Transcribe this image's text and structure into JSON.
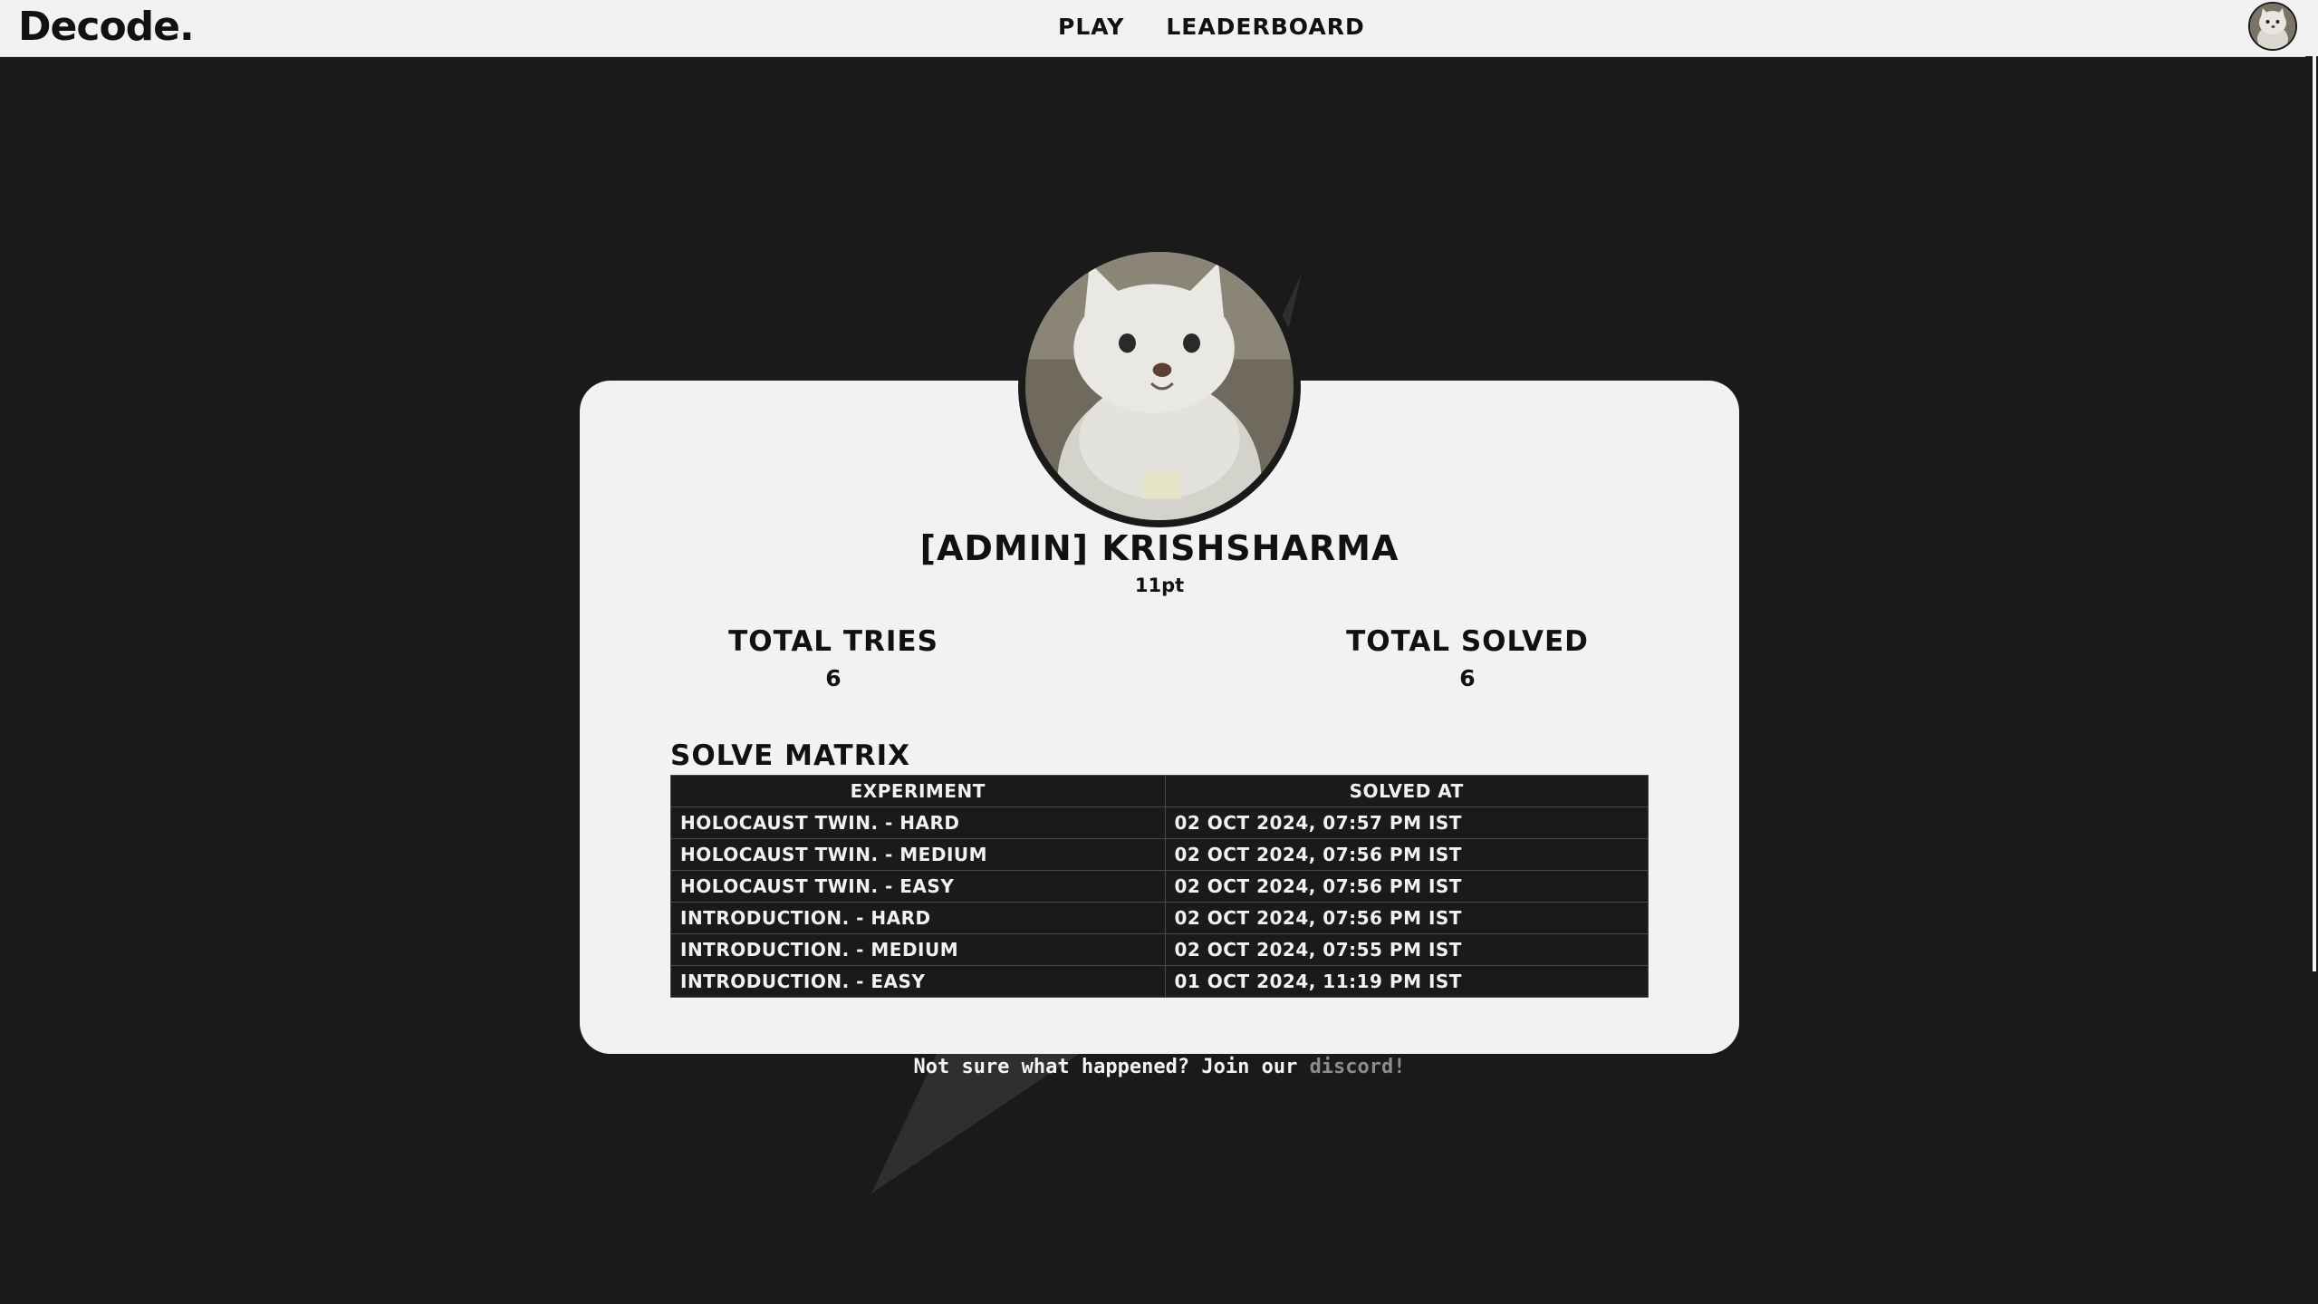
{
  "navbar": {
    "logo": "Decode.",
    "links": [
      "PLAY",
      "LEADERBOARD"
    ]
  },
  "profile": {
    "username": "[ADMIN] KRISHSHARMA",
    "points": "11pt",
    "total_tries_label": "TOTAL TRIES",
    "total_tries_value": "6",
    "total_solved_label": "TOTAL SOLVED",
    "total_solved_value": "6"
  },
  "solve_matrix": {
    "title": "SOLVE MATRIX",
    "headers": [
      "EXPERIMENT",
      "SOLVED AT"
    ],
    "rows": [
      [
        "HOLOCAUST TWIN. - HARD",
        "02 OCT 2024, 07:57 PM IST"
      ],
      [
        "HOLOCAUST TWIN. - MEDIUM",
        "02 OCT 2024, 07:56 PM IST"
      ],
      [
        "HOLOCAUST TWIN. - EASY",
        "02 OCT 2024, 07:56 PM IST"
      ],
      [
        "INTRODUCTION. - HARD",
        "02 OCT 2024, 07:56 PM IST"
      ],
      [
        "INTRODUCTION. - MEDIUM",
        "02 OCT 2024, 07:55 PM IST"
      ],
      [
        "INTRODUCTION. - EASY",
        "01 OCT 2024, 11:19 PM IST"
      ]
    ]
  },
  "footer": {
    "text": "Not sure what happened? Join our ",
    "link": "discord!"
  },
  "colors": {
    "background": "#1a1a1a",
    "card": "#f2f2f2",
    "navbar": "#f2f2f2",
    "link_muted": "#8c8c8c"
  },
  "icons": {
    "nav_avatar": "cat-avatar-icon",
    "profile_avatar": "cat-avatar-icon"
  }
}
